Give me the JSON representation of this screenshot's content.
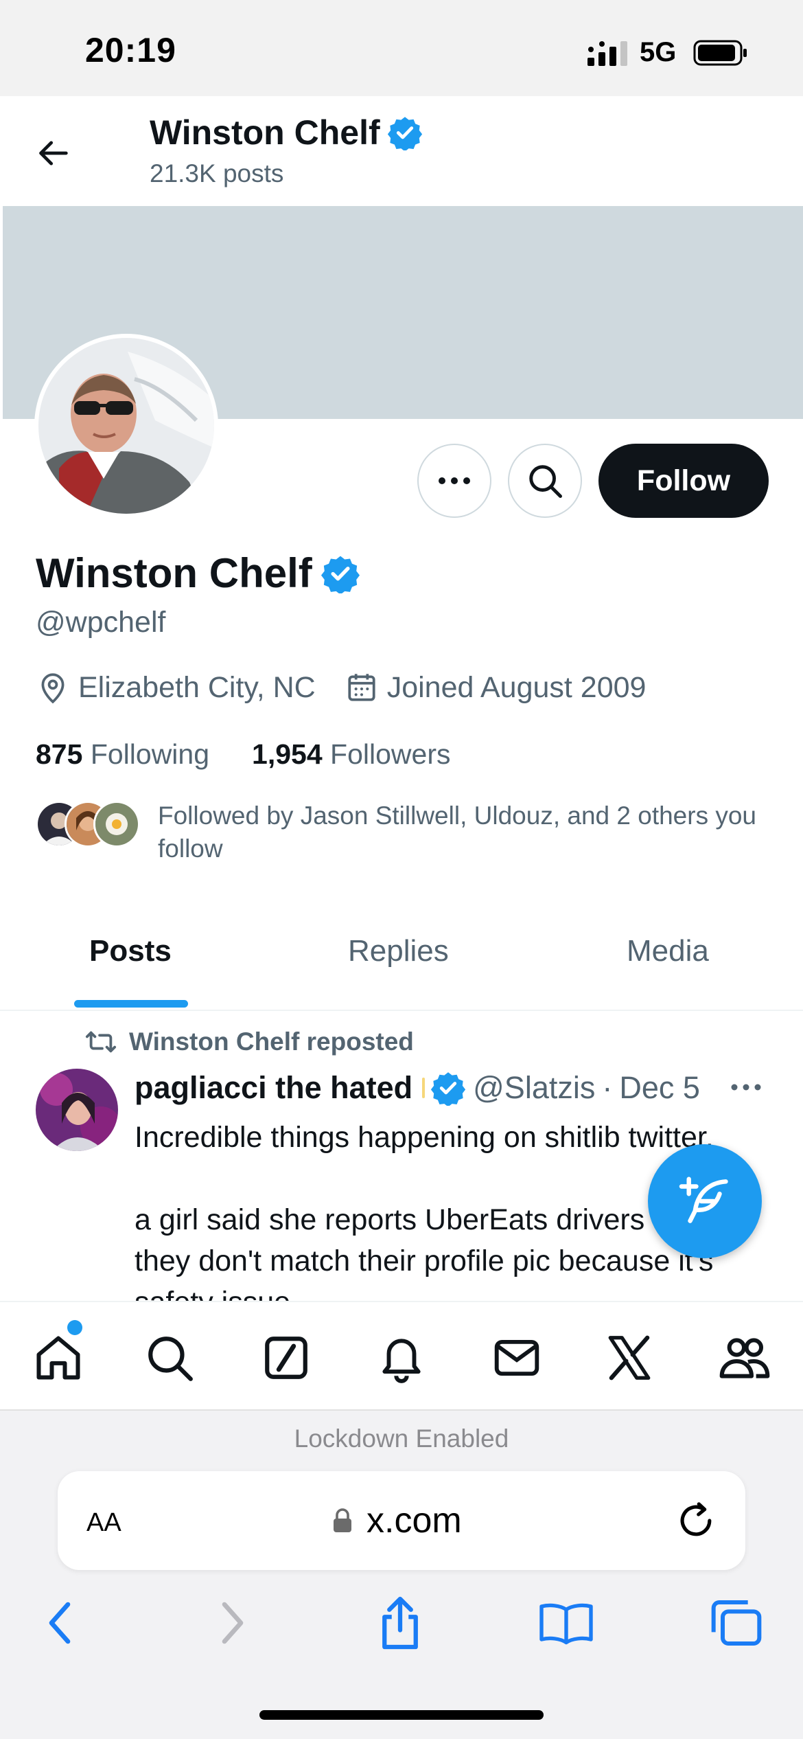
{
  "status_bar": {
    "time": "20:19",
    "network": "5G"
  },
  "header": {
    "title": "Winston Chelf",
    "posts_count": "21.3K posts"
  },
  "profile": {
    "name": "Winston Chelf",
    "handle": "@wpchelf",
    "location": "Elizabeth City, NC",
    "joined": "Joined August 2009",
    "following_count": "875",
    "following_label": "Following",
    "followers_count": "1,954",
    "followers_label": "Followers",
    "followed_by": "Followed by Jason Stillwell, Uldouz, and 2 others you follow"
  },
  "actions": {
    "follow_label": "Follow"
  },
  "tabs": [
    {
      "label": "Posts",
      "active": true
    },
    {
      "label": "Replies",
      "active": false
    },
    {
      "label": "Media",
      "active": false
    }
  ],
  "post": {
    "repost_label": "Winston Chelf reposted",
    "author": "pagliacci the hated",
    "handle": "@Slatzis",
    "separator": "·",
    "date": "Dec 5",
    "text": "Incredible things happening on shitlib twitter.\n\na girl said she reports UberEats drivers when they don't match their profile pic because it's safety issue"
  },
  "bottom_nav": [
    "home-icon",
    "search-icon",
    "grok-icon",
    "notifications-icon",
    "messages-icon",
    "x-premium-icon",
    "communities-icon"
  ],
  "browser": {
    "lockdown_text": "Lockdown Enabled",
    "text_size_label": "AA",
    "url": "x.com"
  },
  "colors": {
    "accent": "#1d9bf0",
    "text_primary": "#0f1419",
    "text_secondary": "#536471",
    "banner": "#cfd9de",
    "follow_button": "#0f1419",
    "safari_blue": "#1a7cf5"
  }
}
